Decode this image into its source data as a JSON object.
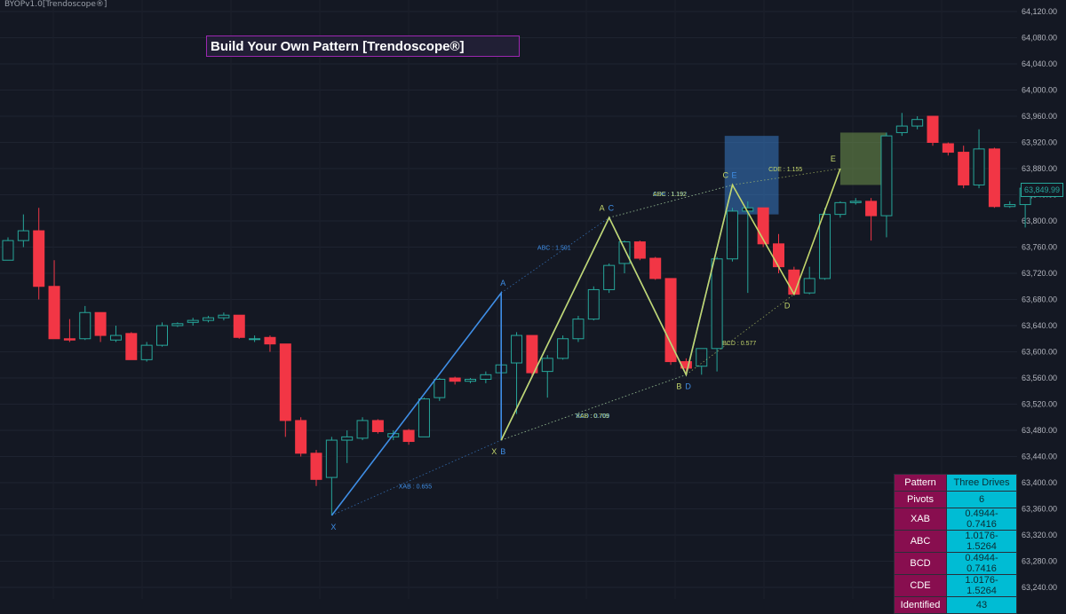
{
  "indicator": {
    "label": "BYOPv1.0[Trendoscope®]"
  },
  "title": "Build Your Own Pattern [Trendoscope®]",
  "colors": {
    "up": "#26a69a",
    "down": "#f23645",
    "blue": "#3f8ee6",
    "yellow": "#c3d66c",
    "magenta": "#9c27b0",
    "cyan": "#00bcd4",
    "maroon": "#880e4f"
  },
  "price_tag": "63,849.99",
  "chart_data": {
    "type": "candlestick",
    "ylim": [
      63240,
      64120
    ],
    "y_ticks": [
      "64,120.00",
      "64,080.00",
      "64,040.00",
      "64,000.00",
      "63,960.00",
      "63,920.00",
      "63,880.00",
      "63,840.00",
      "63,800.00",
      "63,760.00",
      "63,720.00",
      "63,680.00",
      "63,640.00",
      "63,600.00",
      "63,560.00",
      "63,520.00",
      "63,480.00",
      "63,440.00",
      "63,400.00",
      "63,360.00",
      "63,320.00",
      "63,280.00",
      "63,240.00"
    ],
    "candles": [
      {
        "o": 63740,
        "h": 63775,
        "l": 63740,
        "c": 63770
      },
      {
        "o": 63770,
        "h": 63810,
        "l": 63760,
        "c": 63785
      },
      {
        "o": 63785,
        "h": 63820,
        "l": 63680,
        "c": 63700
      },
      {
        "o": 63700,
        "h": 63740,
        "l": 63620,
        "c": 63620
      },
      {
        "o": 63620,
        "h": 63650,
        "l": 63615,
        "c": 63618
      },
      {
        "o": 63620,
        "h": 63670,
        "l": 63618,
        "c": 63660
      },
      {
        "o": 63660,
        "h": 63660,
        "l": 63615,
        "c": 63625
      },
      {
        "o": 63618,
        "h": 63640,
        "l": 63615,
        "c": 63625
      },
      {
        "o": 63628,
        "h": 63630,
        "l": 63590,
        "c": 63588
      },
      {
        "o": 63588,
        "h": 63615,
        "l": 63585,
        "c": 63610
      },
      {
        "o": 63610,
        "h": 63645,
        "l": 63608,
        "c": 63640
      },
      {
        "o": 63640,
        "h": 63645,
        "l": 63638,
        "c": 63643
      },
      {
        "o": 63645,
        "h": 63652,
        "l": 63640,
        "c": 63648
      },
      {
        "o": 63648,
        "h": 63655,
        "l": 63645,
        "c": 63652
      },
      {
        "o": 63652,
        "h": 63660,
        "l": 63648,
        "c": 63656
      },
      {
        "o": 63656,
        "h": 63656,
        "l": 63620,
        "c": 63622
      },
      {
        "o": 63620,
        "h": 63625,
        "l": 63615,
        "c": 63620
      },
      {
        "o": 63622,
        "h": 63625,
        "l": 63600,
        "c": 63612
      },
      {
        "o": 63612,
        "h": 63612,
        "l": 63470,
        "c": 63495
      },
      {
        "o": 63495,
        "h": 63500,
        "l": 63440,
        "c": 63445
      },
      {
        "o": 63445,
        "h": 63450,
        "l": 63395,
        "c": 63405
      },
      {
        "o": 63408,
        "h": 63470,
        "l": 63350,
        "c": 63465
      },
      {
        "o": 63465,
        "h": 63480,
        "l": 63430,
        "c": 63470
      },
      {
        "o": 63468,
        "h": 63500,
        "l": 63465,
        "c": 63495
      },
      {
        "o": 63495,
        "h": 63497,
        "l": 63475,
        "c": 63478
      },
      {
        "o": 63470,
        "h": 63480,
        "l": 63465,
        "c": 63475
      },
      {
        "o": 63480,
        "h": 63482,
        "l": 63458,
        "c": 63463
      },
      {
        "o": 63470,
        "h": 63530,
        "l": 63470,
        "c": 63528
      },
      {
        "o": 63530,
        "h": 63560,
        "l": 63525,
        "c": 63558
      },
      {
        "o": 63560,
        "h": 63562,
        "l": 63550,
        "c": 63555
      },
      {
        "o": 63555,
        "h": 63560,
        "l": 63552,
        "c": 63558
      },
      {
        "o": 63558,
        "h": 63570,
        "l": 63552,
        "c": 63565
      },
      {
        "o": 63568,
        "h": 63585,
        "l": 63566,
        "c": 63580
      },
      {
        "o": 63583,
        "h": 63630,
        "l": 63505,
        "c": 63625
      },
      {
        "o": 63625,
        "h": 63625,
        "l": 63560,
        "c": 63568
      },
      {
        "o": 63570,
        "h": 63595,
        "l": 63530,
        "c": 63590
      },
      {
        "o": 63590,
        "h": 63625,
        "l": 63588,
        "c": 63620
      },
      {
        "o": 63620,
        "h": 63655,
        "l": 63615,
        "c": 63650
      },
      {
        "o": 63650,
        "h": 63700,
        "l": 63648,
        "c": 63695
      },
      {
        "o": 63695,
        "h": 63735,
        "l": 63690,
        "c": 63732
      },
      {
        "o": 63735,
        "h": 63770,
        "l": 63720,
        "c": 63768
      },
      {
        "o": 63768,
        "h": 63770,
        "l": 63740,
        "c": 63743
      },
      {
        "o": 63743,
        "h": 63745,
        "l": 63710,
        "c": 63712
      },
      {
        "o": 63712,
        "h": 63712,
        "l": 63580,
        "c": 63585
      },
      {
        "o": 63585,
        "h": 63590,
        "l": 63570,
        "c": 63575
      },
      {
        "o": 63578,
        "h": 63605,
        "l": 63565,
        "c": 63605
      },
      {
        "o": 63605,
        "h": 63745,
        "l": 63570,
        "c": 63742
      },
      {
        "o": 63742,
        "h": 63820,
        "l": 63738,
        "c": 63815
      },
      {
        "o": 63815,
        "h": 63830,
        "l": 63690,
        "c": 63820
      },
      {
        "o": 63820,
        "h": 63820,
        "l": 63760,
        "c": 63765
      },
      {
        "o": 63765,
        "h": 63780,
        "l": 63720,
        "c": 63730
      },
      {
        "o": 63725,
        "h": 63730,
        "l": 63690,
        "c": 63688
      },
      {
        "o": 63690,
        "h": 63730,
        "l": 63688,
        "c": 63712
      },
      {
        "o": 63712,
        "h": 63820,
        "l": 63710,
        "c": 63810
      },
      {
        "o": 63810,
        "h": 63830,
        "l": 63805,
        "c": 63828
      },
      {
        "o": 63828,
        "h": 63835,
        "l": 63825,
        "c": 63830
      },
      {
        "o": 63830,
        "h": 63835,
        "l": 63770,
        "c": 63808
      },
      {
        "o": 63808,
        "h": 63935,
        "l": 63775,
        "c": 63930
      },
      {
        "o": 63935,
        "h": 63965,
        "l": 63930,
        "c": 63945
      },
      {
        "o": 63945,
        "h": 63960,
        "l": 63940,
        "c": 63955
      },
      {
        "o": 63960,
        "h": 63960,
        "l": 63915,
        "c": 63920
      },
      {
        "o": 63918,
        "h": 63920,
        "l": 63900,
        "c": 63905
      },
      {
        "o": 63905,
        "h": 63915,
        "l": 63850,
        "c": 63855
      },
      {
        "o": 63855,
        "h": 63940,
        "l": 63850,
        "c": 63910
      },
      {
        "o": 63910,
        "h": 63912,
        "l": 63820,
        "c": 63822
      },
      {
        "o": 63822,
        "h": 63830,
        "l": 63820,
        "c": 63825
      },
      {
        "o": 63825,
        "h": 63850,
        "l": 63790,
        "c": 63850
      }
    ],
    "patterns": [
      {
        "name": "blue",
        "color": "#3f8ee6",
        "points": [
          {
            "label": "X",
            "i": 21,
            "p": 63350
          },
          {
            "label": "A",
            "i": 32,
            "p": 63690
          },
          {
            "label": "B",
            "i": 32,
            "p": 63465
          },
          {
            "label": "C",
            "i": 39,
            "p": 63805
          },
          {
            "label": "D",
            "i": 44,
            "p": 63565
          },
          {
            "label": "E",
            "i": 47,
            "p": 63855
          }
        ],
        "ratios": [
          {
            "label": "XAB : 0.655"
          },
          {
            "label": "ABC : 1.501"
          },
          {
            "label": "BCD : 0.709"
          },
          {
            "label": "CDE : 1.192"
          }
        ],
        "box": {
          "i0": 46.5,
          "i1": 50,
          "p0": 63810,
          "p1": 63930
        }
      },
      {
        "name": "yellow",
        "color": "#c3d66c",
        "points": [
          {
            "label": "X",
            "i": 32,
            "p": 63465
          },
          {
            "label": "A",
            "i": 39,
            "p": 63805
          },
          {
            "label": "B",
            "i": 44,
            "p": 63565
          },
          {
            "label": "C",
            "i": 47,
            "p": 63855
          },
          {
            "label": "D",
            "i": 51,
            "p": 63688
          },
          {
            "label": "E",
            "i": 54,
            "p": 63880
          }
        ],
        "ratios": [
          {
            "label": "XAB : 0.709"
          },
          {
            "label": "ABC : 1.192"
          },
          {
            "label": "BCD : 0.577"
          },
          {
            "label": "CDE : 1.155"
          }
        ],
        "box": {
          "i0": 54,
          "i1": 57,
          "p0": 63855,
          "p1": 63935
        }
      }
    ]
  },
  "info_table": [
    {
      "k": "Pattern",
      "v": "Three Drives"
    },
    {
      "k": "Pivots",
      "v": "6"
    },
    {
      "k": "XAB",
      "v": "0.4944-0.7416"
    },
    {
      "k": "ABC",
      "v": "1.0176-1.5264"
    },
    {
      "k": "BCD",
      "v": "0.4944-0.7416"
    },
    {
      "k": "CDE",
      "v": "1.0176-1.5264"
    },
    {
      "k": "Identified",
      "v": "43"
    }
  ]
}
